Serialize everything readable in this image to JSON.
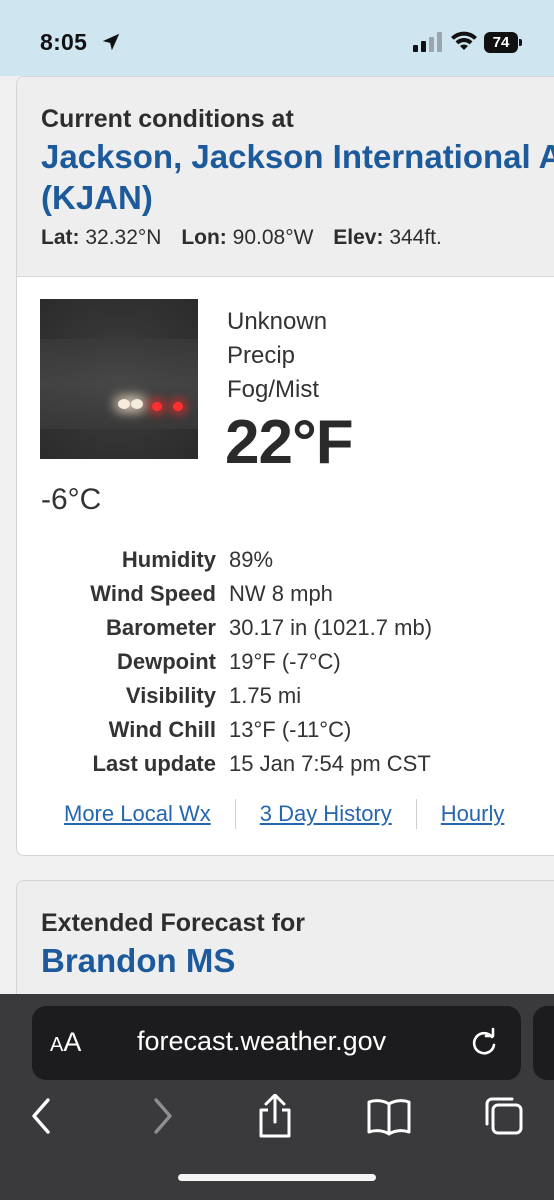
{
  "status_bar": {
    "time": "8:05",
    "battery": "74"
  },
  "current": {
    "header_label": "Current conditions at",
    "station_line1": "Jackson, Jackson International Airport",
    "station_line2": "(KJAN)",
    "lat_label": "Lat:",
    "lat_value": "32.32°N",
    "lon_label": "Lon:",
    "lon_value": "90.08°W",
    "elev_label": "Elev:",
    "elev_value": "344ft.",
    "condition_lines": [
      "Unknown",
      "Precip",
      "Fog/Mist"
    ],
    "temp_f": "22°F",
    "temp_c": "-6°C",
    "details": [
      {
        "label": "Humidity",
        "value": "89%"
      },
      {
        "label": "Wind Speed",
        "value": "NW 8 mph"
      },
      {
        "label": "Barometer",
        "value": "30.17 in (1021.7 mb)"
      },
      {
        "label": "Dewpoint",
        "value": "19°F (-7°C)"
      },
      {
        "label": "Visibility",
        "value": "1.75 mi"
      },
      {
        "label": "Wind Chill",
        "value": "13°F (-11°C)"
      },
      {
        "label": "Last update",
        "value": "15 Jan 7:54 pm CST"
      }
    ],
    "links": [
      "More Local Wx",
      "3 Day History",
      "Hourly"
    ]
  },
  "forecast": {
    "header_label": "Extended Forecast for",
    "location": "Brandon MS"
  },
  "browser": {
    "aa_label_small": "A",
    "aa_label_large": "A",
    "url": "forecast.weather.gov"
  }
}
